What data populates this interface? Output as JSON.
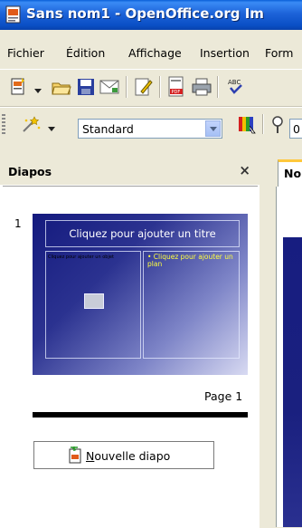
{
  "window": {
    "title": "Sans nom1 - OpenOffice.org Im"
  },
  "menu": {
    "items": [
      "Fichier",
      "Édition",
      "Affichage",
      "Insertion",
      "Form"
    ]
  },
  "toolbar2": {
    "style_value": "Standard",
    "zoom_value": "0"
  },
  "slides_panel": {
    "title": "Diapos",
    "close_glyph": "×",
    "slide_number": "1",
    "thumbnail": {
      "title_placeholder": "Cliquez pour ajouter un titre",
      "left_text": "Cliquez pour ajouter un objet",
      "right_text": "• Cliquez pour ajouter un plan"
    },
    "page_label": "Page 1",
    "new_slide_button": "Nouvelle diapo"
  },
  "tabs": [
    {
      "label": "No"
    }
  ],
  "icons": {
    "app": "impress-icon",
    "new": "new-document-icon",
    "open": "open-folder-icon",
    "save": "save-icon",
    "mail": "mail-icon",
    "edit": "edit-file-icon",
    "pdf": "export-pdf-icon",
    "print": "print-icon",
    "spell": "spellcheck-icon",
    "stylist": "stylist-icon",
    "color": "color-bar-icon",
    "pointer": "pointer-icon",
    "zoom": "zoom-icon"
  }
}
